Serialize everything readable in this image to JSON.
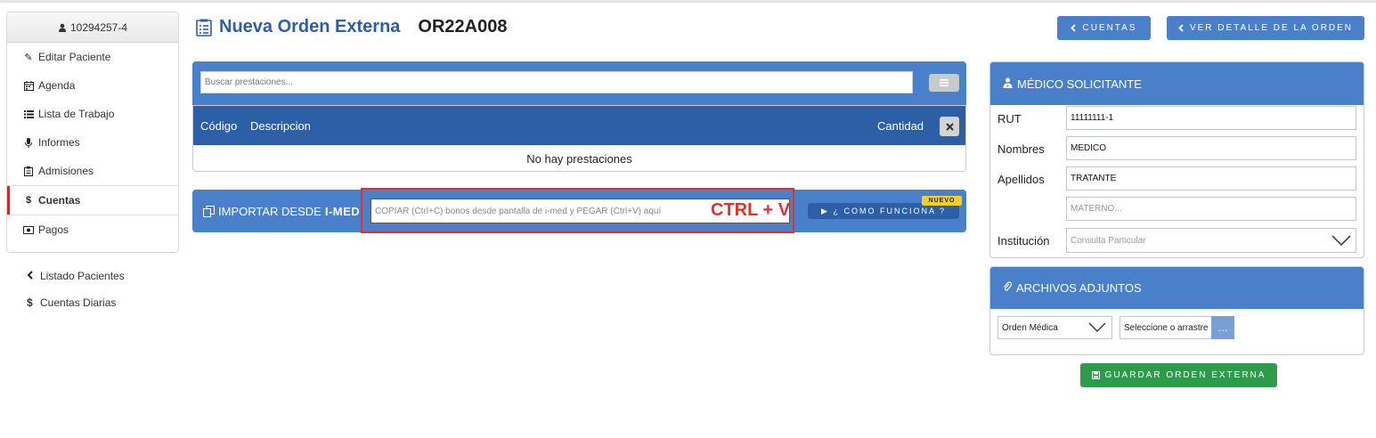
{
  "patient": {
    "id": "10294257-4"
  },
  "sidebar": {
    "items": [
      {
        "label": "Editar Paciente",
        "icon": "pencil-icon"
      },
      {
        "label": "Agenda",
        "icon": "calendar-icon"
      },
      {
        "label": "Lista de Trabajo",
        "icon": "list-icon"
      },
      {
        "label": "Informes",
        "icon": "microphone-icon"
      },
      {
        "label": "Admisiones",
        "icon": "clipboard-icon"
      },
      {
        "label": "Cuentas",
        "icon": "dollar-icon",
        "active": true
      },
      {
        "label": "Pagos",
        "icon": "money-icon"
      }
    ],
    "links": [
      {
        "label": "Listado Pacientes",
        "icon": "chevron-left-icon"
      },
      {
        "label": "Cuentas Diarias",
        "icon": "dollar-icon"
      }
    ]
  },
  "header": {
    "title": "Nueva Orden Externa",
    "order_code": "OR22A008",
    "btn_cuentas": "CUENTAS",
    "btn_detalle": "VER DETALLE DE LA ORDEN"
  },
  "search": {
    "placeholder": "Buscar prestaciones..."
  },
  "table": {
    "col_codigo": "Código",
    "col_descripcion": "Descripcion",
    "col_cantidad": "Cantidad",
    "empty": "No hay prestaciones"
  },
  "import": {
    "label_prefix": "IMPORTAR DESDE",
    "label_bold": "I-MED",
    "placeholder": "COPIAR (Ctrl+C) bonos desde pantalla de i-med y PEGAR (Ctrl+V) aquí",
    "hint": "CTRL + V",
    "help_btn": "▶ ¿ COMO FUNCIONA ?",
    "badge": "NUEVO"
  },
  "medico": {
    "title": "MÉDICO SOLICITANTE",
    "rut_label": "RUT",
    "rut": "11111111-1",
    "nombres_label": "Nombres",
    "nombres": "MEDICO",
    "apellidos_label": "Apellidos",
    "apellido_paterno": "TRATANTE",
    "apellido_materno_placeholder": "MATERNO...",
    "institucion_label": "Institución",
    "institucion_placeholder": "Consulta Particular"
  },
  "adjuntos": {
    "title": "ARCHIVOS ADJUNTOS",
    "tipo": "Orden Médica",
    "file_placeholder": "Seleccione o arrastre",
    "browse": "…"
  },
  "save_btn": "GUARDAR ORDEN EXTERNA",
  "colors": {
    "primary": "#4a80c9",
    "dark_blue": "#2d5fa7",
    "accent_red": "#e03131",
    "success": "#2e9b4a"
  }
}
